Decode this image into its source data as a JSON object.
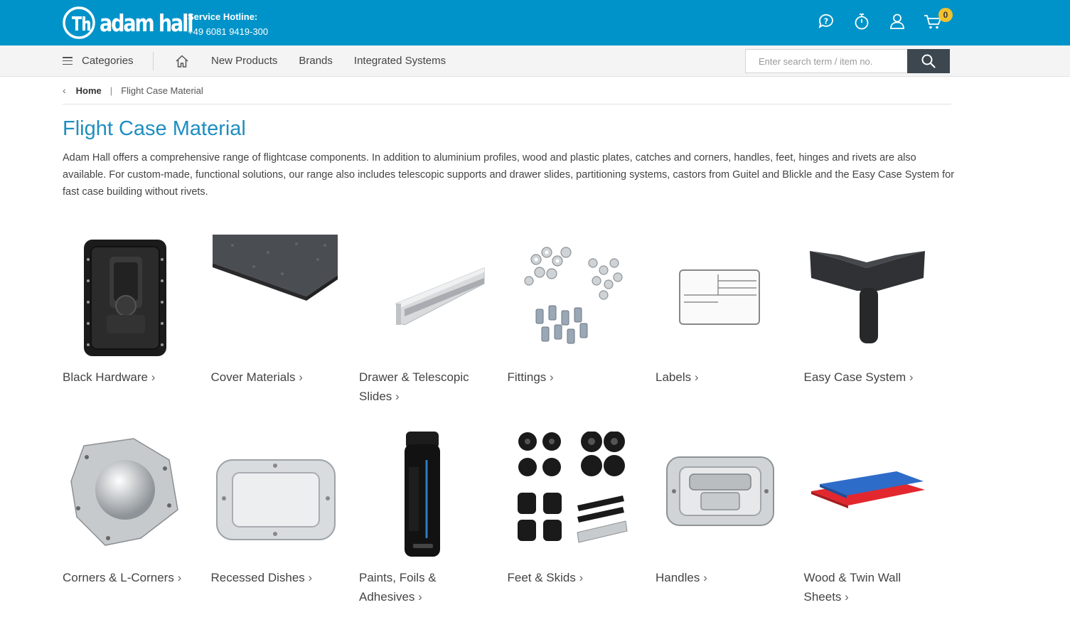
{
  "brand": {
    "logo_text": "adam hall"
  },
  "hotline": {
    "title": "Service Hotline:",
    "number": "+49 6081 9419-300"
  },
  "header_icons": [
    "chat-question-icon",
    "stopwatch-icon",
    "user-icon",
    "cart-icon"
  ],
  "cart": {
    "count": "0"
  },
  "nav": {
    "categories_label": "Categories",
    "links": [
      "New Products",
      "Brands",
      "Integrated Systems"
    ]
  },
  "search": {
    "placeholder": "Enter search term / item no.",
    "value": ""
  },
  "breadcrumb": {
    "back": "‹",
    "home": "Home",
    "separator": "|",
    "current": "Flight Case Material"
  },
  "page": {
    "title": "Flight Case Material",
    "intro": "Adam Hall offers a comprehensive range of flightcase components. In addition to aluminium profiles, wood and plastic plates, catches and corners, handles, feet, hinges and rivets are also available. For custom-made, functional solutions, our range also includes telescopic supports and drawer slides, partitioning systems, castors from Guitel and Blickle and the Easy Case System for fast case building without rivets."
  },
  "categories": [
    {
      "label": "Black Hardware",
      "image": "black-hardware"
    },
    {
      "label": "Cover Materials",
      "image": "cover-materials"
    },
    {
      "label": "Drawer & Telescopic Slides",
      "image": "drawer-slides"
    },
    {
      "label": "Fittings",
      "image": "fittings"
    },
    {
      "label": "Labels",
      "image": "labels"
    },
    {
      "label": "Easy Case System",
      "image": "easy-case"
    },
    {
      "label": "Corners & L-Corners",
      "image": "corners"
    },
    {
      "label": "Recessed Dishes",
      "image": "recessed-dish"
    },
    {
      "label": "Paints, Foils & Adhesives",
      "image": "spray-can"
    },
    {
      "label": "Feet & Skids",
      "image": "feet"
    },
    {
      "label": "Handles",
      "image": "handle"
    },
    {
      "label": "Wood & Twin Wall Sheets",
      "image": "sheets"
    }
  ],
  "colors": {
    "header": "#0093c9",
    "title": "#1f8ec0",
    "badge": "#f2c12e",
    "search_button": "#3c4750"
  }
}
